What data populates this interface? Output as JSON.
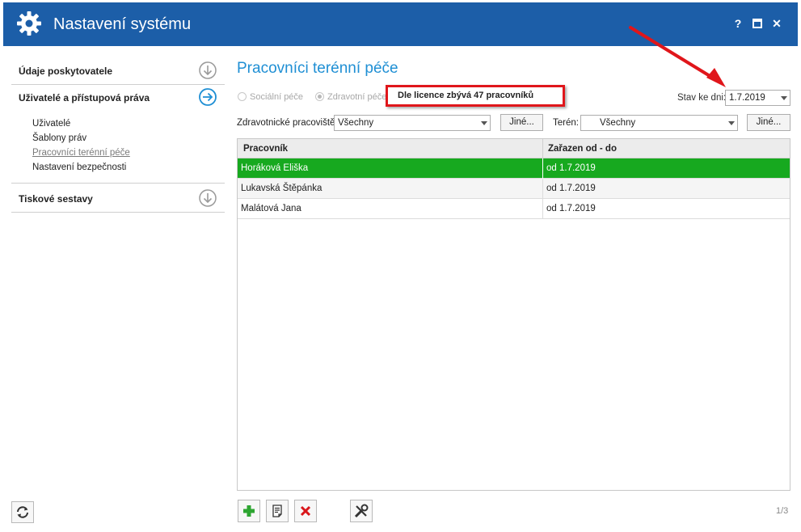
{
  "window": {
    "title": "Nastavení systému",
    "help_label": "?",
    "close_label": "✕",
    "gear_icon": "gear-icon",
    "accent_color": "#1c5ea8"
  },
  "sidebar": {
    "sections": [
      {
        "label": "Údaje poskytovatele",
        "icon": "arrow-down-circle-icon"
      },
      {
        "label": "Uživatelé a přístupová práva",
        "icon": "arrow-right-circle-icon"
      },
      {
        "label": "Tiskové sestavy",
        "icon": "arrow-down-circle-icon"
      }
    ],
    "sub_items": [
      "Uživatelé",
      "Šablony práv",
      "Pracovníci terénní péče",
      "Nastavení bezpečnosti"
    ]
  },
  "main": {
    "title": "Pracovníci terénní péče",
    "radio_social": "Sociální péče",
    "radio_health": "Zdravotní péče",
    "license_text": "Dle licence zbývá 47 pracovníků",
    "stav_label": "Stav ke dni:",
    "stav_value": "1.7.2019",
    "workplace_label": "Zdravotnické pracoviště:",
    "workplace_value": "Všechny",
    "jine_label": "Jiné...",
    "teren_label": "Terén:",
    "teren_value": "Všechny"
  },
  "grid": {
    "columns": [
      "Pracovník",
      "Zařazen od - do"
    ],
    "rows": [
      [
        "Horáková Eliška",
        "od 1.7.2019"
      ],
      [
        "Lukavská Štěpánka",
        "od 1.7.2019"
      ],
      [
        "Malátová Jana",
        "od 1.7.2019"
      ]
    ],
    "selected_color": "#17a91f"
  },
  "footer": {
    "pager": "1/3",
    "add_icon": "plus-icon",
    "edit_icon": "document-icon",
    "delete_icon": "delete-x-icon",
    "tools_icon": "tools-icon",
    "refresh_icon": "refresh-icon"
  }
}
